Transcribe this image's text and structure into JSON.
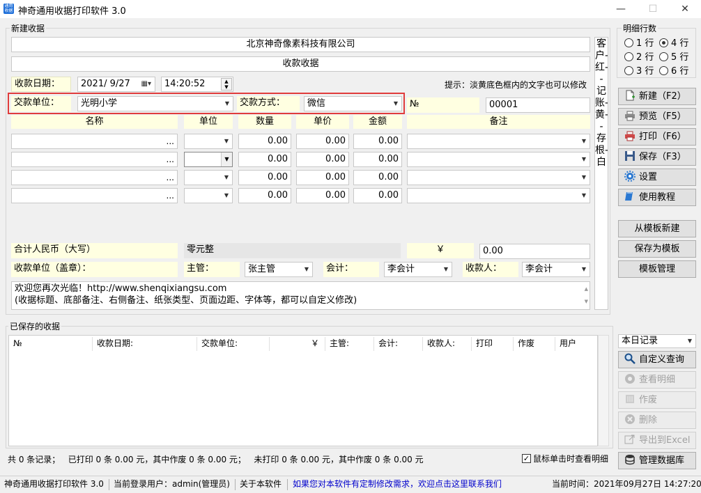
{
  "window": {
    "title": "神奇通用收据打印软件 3.0",
    "icon_text": "通用收据"
  },
  "new_receipt": {
    "group_label": "新建收据",
    "company": "北京神奇像素科技有限公司",
    "receipt_title": "收款收据",
    "date_label": "收款日期：",
    "date_value": "2021/  9/27",
    "time_value": "14:20:52",
    "hint": "提示：淡黄底色框内的文字也可以修改",
    "payer_label": "交款单位：",
    "payer_value": "光明小学",
    "method_label": "交款方式：",
    "method_value": "微信",
    "no_label": "№",
    "no_value": "00001",
    "columns": [
      "名称",
      "单位",
      "数量",
      "单价",
      "金额",
      "备注"
    ],
    "rows": [
      {
        "qty": "0.00",
        "price": "0.00",
        "amount": "0.00"
      },
      {
        "qty": "0.00",
        "price": "0.00",
        "amount": "0.00"
      },
      {
        "qty": "0.00",
        "price": "0.00",
        "amount": "0.00"
      },
      {
        "qty": "0.00",
        "price": "0.00",
        "amount": "0.00"
      }
    ],
    "total_label": "合计人民币（大写）",
    "total_words": "零元整",
    "yen": "￥",
    "total_value": "0.00",
    "seal_label": "收款单位（盖章）：",
    "manager_label": "主管：",
    "manager_value": "张主管",
    "accountant_label": "会计：",
    "accountant_value": "李会计",
    "cashier_label": "收款人：",
    "cashier_value": "李会计",
    "footer_note_line1": "欢迎您再次光临！http://www.shenqixiangsu.com",
    "footer_note_line2": "(收据标题、底部备注、右侧备注、纸张类型、页面边距、字体等，都可以自定义修改)",
    "side_note": "客户-红--记账-黄--存根-白"
  },
  "detail_rows": {
    "label": "明细行数",
    "options": [
      "1 行",
      "2 行",
      "3 行",
      "4 行",
      "5 行",
      "6 行"
    ],
    "selected": "4 行"
  },
  "actions": {
    "new": "新建（F2）",
    "preview": "预览（F5）",
    "print": "打印（F6）",
    "save": "保存（F3）",
    "settings": "设置",
    "tutorial": "使用教程",
    "from_template": "从模板新建",
    "save_template": "保存为模板",
    "template_manage": "模板管理"
  },
  "saved": {
    "group_label": "已保存的收据",
    "columns": [
      "№",
      "收款日期:",
      "交款单位:",
      "￥",
      "主管:",
      "会计:",
      "收款人:",
      "打印",
      "作废",
      "用户"
    ],
    "summary": "共 0 条记录；   已打印 0 条 0.00 元，其中作废 0 条 0.00 元；   未打印 0 条 0.00 元，其中作废 0 条 0.00 元",
    "click_detail": "鼠标单击时查看明细"
  },
  "filter": {
    "range": "本日记录",
    "custom_query": "自定义查询",
    "view_detail": "查看明细",
    "void": "作废",
    "delete": "删除",
    "export": "导出到Excel",
    "manage_db": "管理数据库"
  },
  "status": {
    "app": "神奇通用收据打印软件 3.0",
    "user": "当前登录用户：admin(管理员)",
    "about": "关于本软件",
    "link": "如果您对本软件有定制修改需求，欢迎点击这里联系我们",
    "time": "当前时间：2021年09月27日 14:27:20"
  },
  "colors": {
    "highlight_border": "#e03c3c",
    "note_yellow": "#ffffe1",
    "link": "#0000cc"
  }
}
